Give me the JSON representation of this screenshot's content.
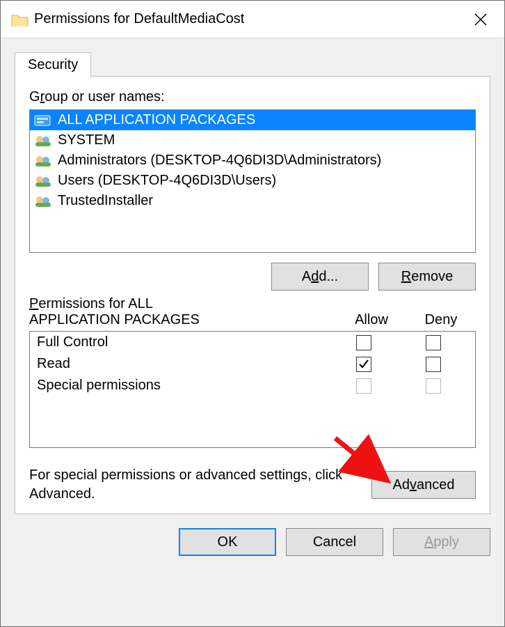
{
  "title": "Permissions for DefaultMediaCost",
  "tab": "Security",
  "groupsLabelPre": "G",
  "groupsLabelHot": "r",
  "groupsLabelPost": "oup or user names:",
  "groups": [
    {
      "label": "ALL APPLICATION PACKAGES",
      "selected": true,
      "iconType": "pkg"
    },
    {
      "label": "SYSTEM",
      "selected": false,
      "iconType": "grp"
    },
    {
      "label": "Administrators (DESKTOP-4Q6DI3D\\Administrators)",
      "selected": false,
      "iconType": "grp"
    },
    {
      "label": "Users (DESKTOP-4Q6DI3D\\Users)",
      "selected": false,
      "iconType": "grp"
    },
    {
      "label": "TrustedInstaller",
      "selected": false,
      "iconType": "grp"
    }
  ],
  "addPre": "A",
  "addHot": "d",
  "addPost": "d...",
  "removePre": "",
  "removeHot": "R",
  "removePost": "emove",
  "permForPre": "P",
  "permForHot": "",
  "permForPost": "ermissions for ALL\nAPPLICATION PACKAGES",
  "colAllow": "Allow",
  "colDeny": "Deny",
  "perms": [
    {
      "name": "Full Control",
      "allow": "unchecked",
      "deny": "unchecked"
    },
    {
      "name": "Read",
      "allow": "checked",
      "deny": "unchecked"
    },
    {
      "name": "Special permissions",
      "allow": "dim",
      "deny": "dim"
    }
  ],
  "advText": "For special permissions or advanced settings, click Advanced.",
  "advancedPre": "Ad",
  "advancedHot": "v",
  "advancedPost": "anced",
  "okLabel": "OK",
  "cancelLabel": "Cancel",
  "applyPre": "",
  "applyHot": "A",
  "applyPost": "pply"
}
